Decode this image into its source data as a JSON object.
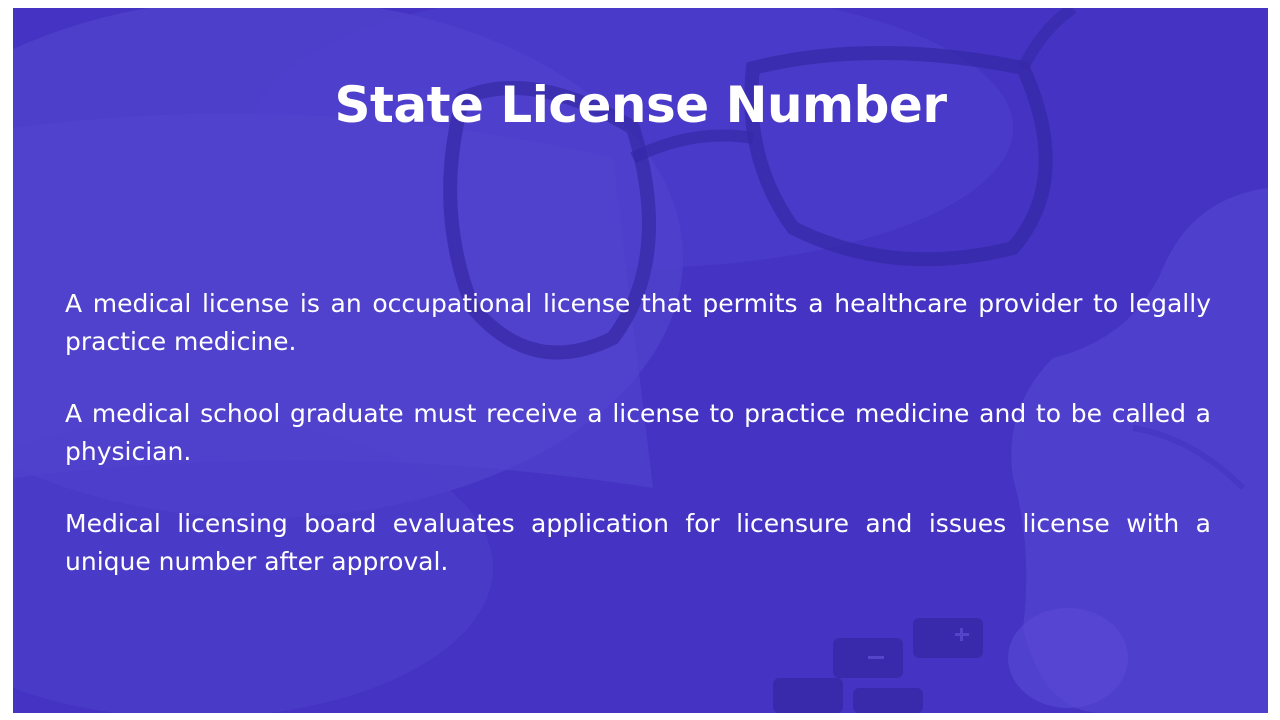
{
  "slide": {
    "title": "State License Number",
    "paragraphs": [
      "A medical license is an occupational license that permits a healthcare provider to legally practice medicine.",
      "A medical school graduate must receive a license to practice medicine and to be called a physician.",
      "Medical licensing board evaluates application for licensure and issues license with a unique number after approval."
    ]
  },
  "colors": {
    "overlay": "#4a3cc4",
    "text": "#ffffff"
  }
}
